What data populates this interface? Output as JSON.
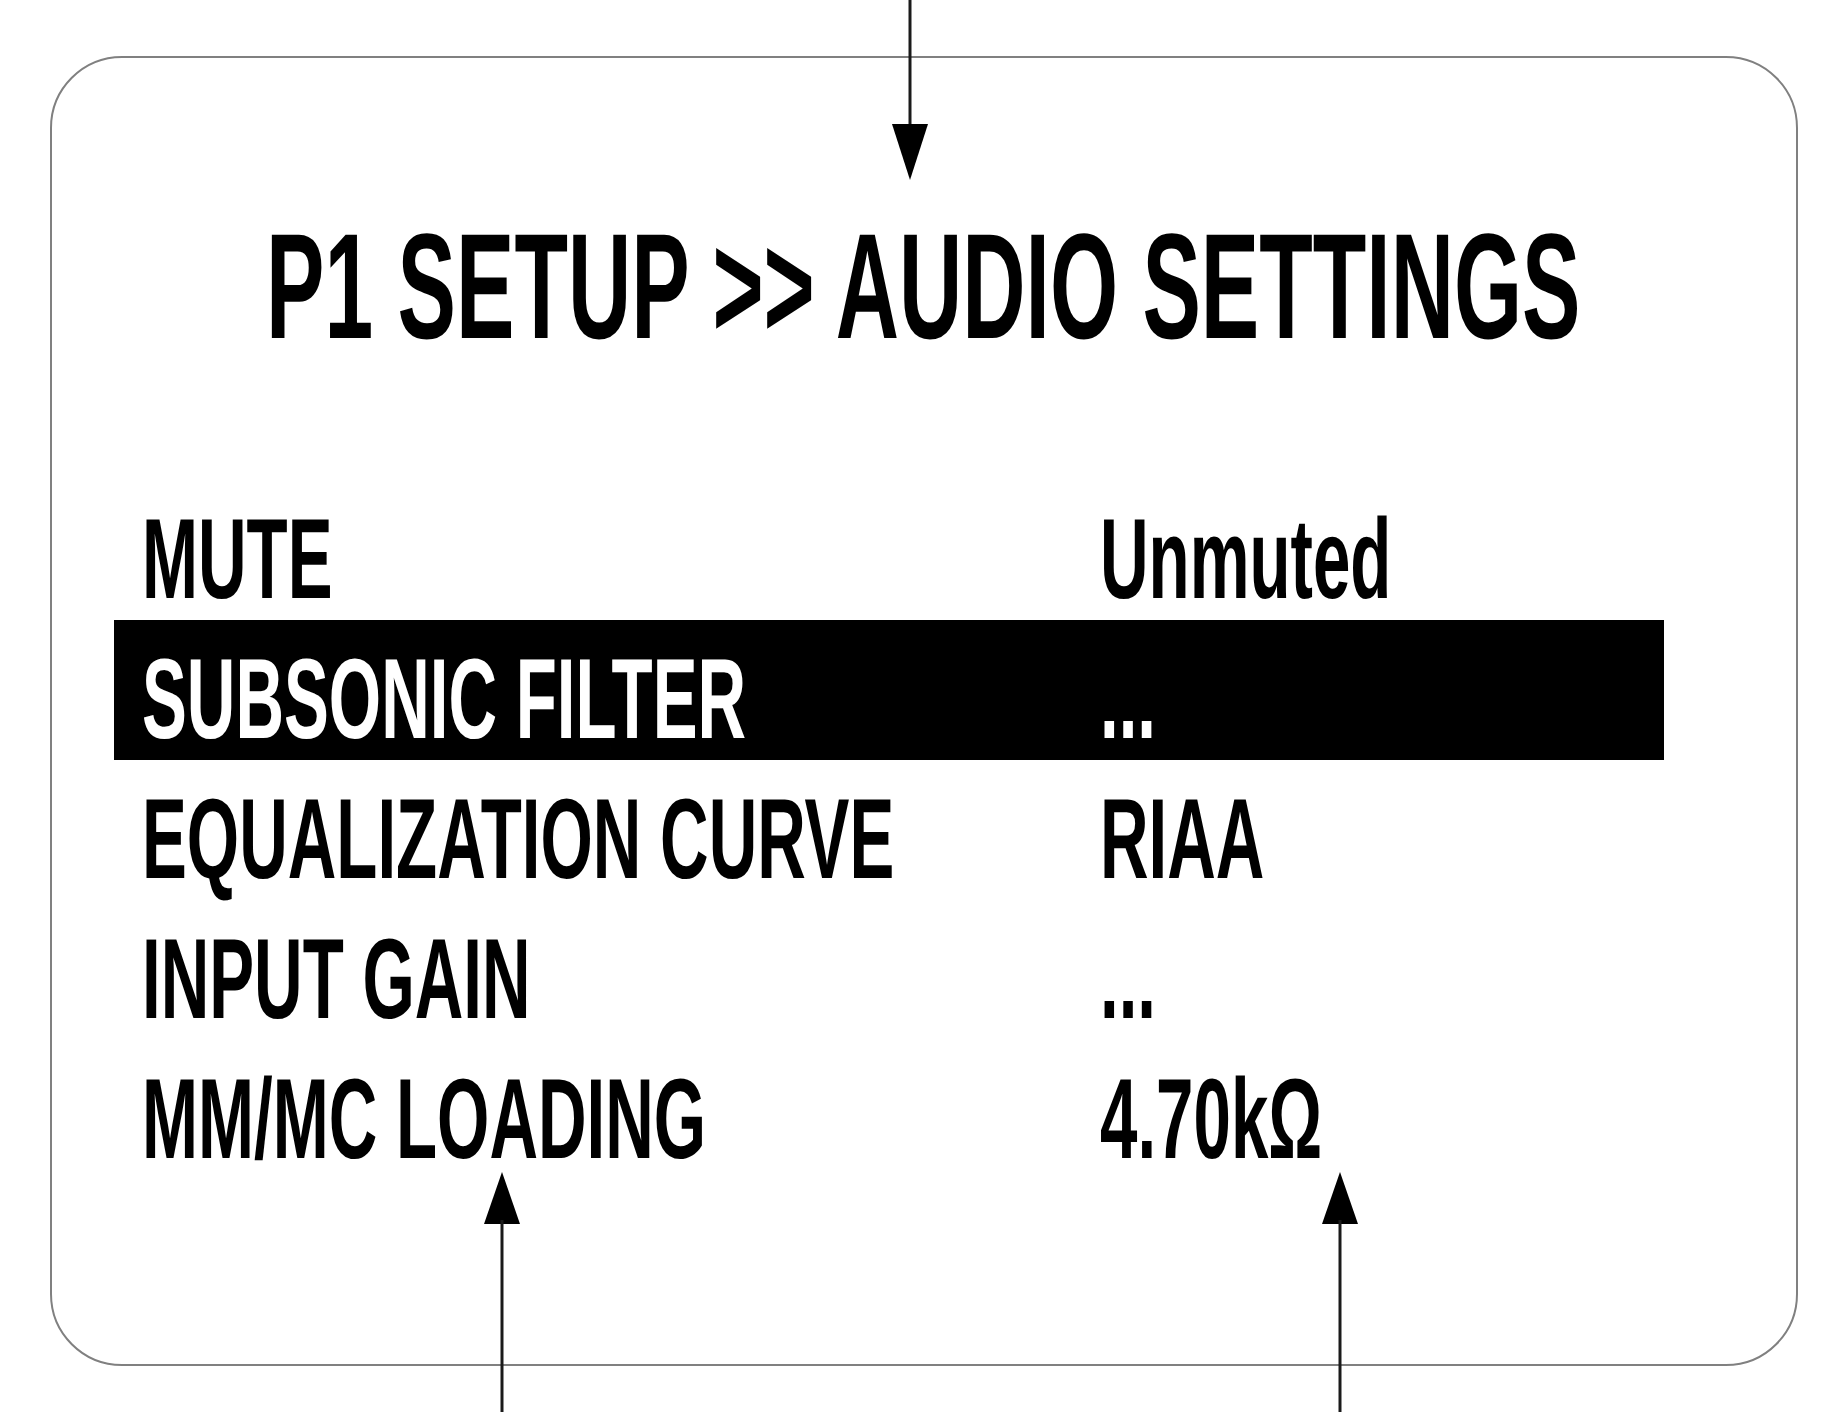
{
  "screen": {
    "title": "P1 SETUP >> AUDIO SETTINGS",
    "menu_items": [
      {
        "label": "MUTE",
        "value": "Unmuted",
        "selected": false
      },
      {
        "label": "SUBSONIC FILTER",
        "value": "...",
        "selected": true
      },
      {
        "label": "EQUALIZATION CURVE",
        "value": "RIAA",
        "selected": false
      },
      {
        "label": "INPUT GAIN",
        "value": "...",
        "selected": false
      },
      {
        "label": "MM/MC LOADING",
        "value": "4.70kΩ",
        "selected": false
      }
    ]
  }
}
